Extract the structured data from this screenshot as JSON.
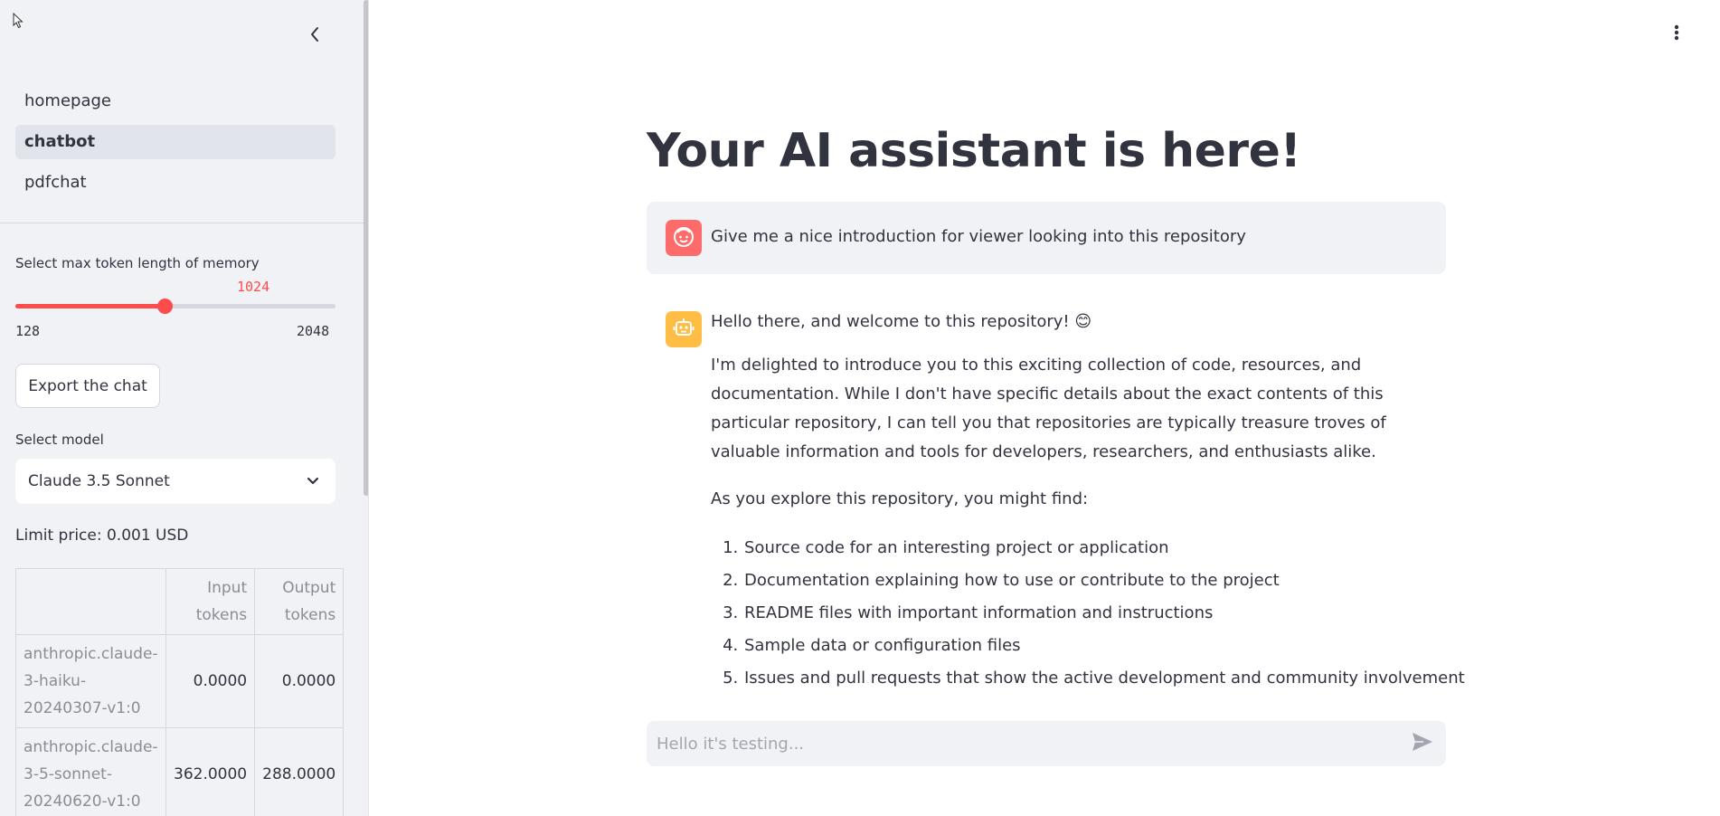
{
  "colors": {
    "accent": "#ff4b4b",
    "sidebar_bg": "#f0f2f6",
    "user_avatar": "#ff6b6b",
    "bot_avatar": "#ffbd45",
    "text": "#31333f"
  },
  "icons": {
    "cursor": "mouse-pointer-icon",
    "collapse": "chevron-left-icon",
    "menu": "vertical-ellipsis-icon",
    "select": "chevron-down-icon",
    "user_avatar": "smiley-face-icon",
    "bot_avatar": "robot-icon",
    "send": "paper-plane-icon"
  },
  "sidebar": {
    "nav": [
      {
        "label": "homepage",
        "active": false
      },
      {
        "label": "chatbot",
        "active": true
      },
      {
        "label": "pdfchat",
        "active": false
      }
    ],
    "memory_slider": {
      "label": "Select max token length of memory",
      "value": 1024,
      "min": 128,
      "max": 2048,
      "value_label": "1024",
      "min_label": "128",
      "max_label": "2048"
    },
    "export_button": "Export the chat",
    "model_select": {
      "label": "Select model",
      "selected": "Claude 3.5 Sonnet"
    },
    "limit_price": "Limit price: 0.001 USD",
    "cost_table": {
      "headers": [
        "",
        "Input tokens",
        "Output tokens"
      ],
      "rows": [
        {
          "model": "anthropic.claude-3-haiku-20240307-v1:0",
          "input": "0.0000",
          "output": "0.0000"
        },
        {
          "model": "anthropic.claude-3-5-sonnet-20240620-v1:0",
          "input": "362.0000",
          "output": "288.0000"
        }
      ]
    }
  },
  "main": {
    "title": "Your AI assistant is here!",
    "user_message": "Give me a nice introduction for viewer looking into this repository",
    "bot_message": {
      "greeting": "Hello there, and welcome to this repository! 😊",
      "paragraphs": [
        "I'm delighted to introduce you to this exciting collection of code, resources, and documentation. While I don't have specific details about the exact contents of this particular repository, I can tell you that repositories are typically treasure troves of valuable information and tools for developers, researchers, and enthusiasts alike.",
        "As you explore this repository, you might find:"
      ],
      "list": [
        "Source code for an interesting project or application",
        "Documentation explaining how to use or contribute to the project",
        "README files with important information and instructions",
        "Sample data or configuration files",
        "Issues and pull requests that show the active development and community involvement"
      ]
    },
    "chat_input": {
      "placeholder": "Hello it's testing...",
      "value": ""
    }
  }
}
